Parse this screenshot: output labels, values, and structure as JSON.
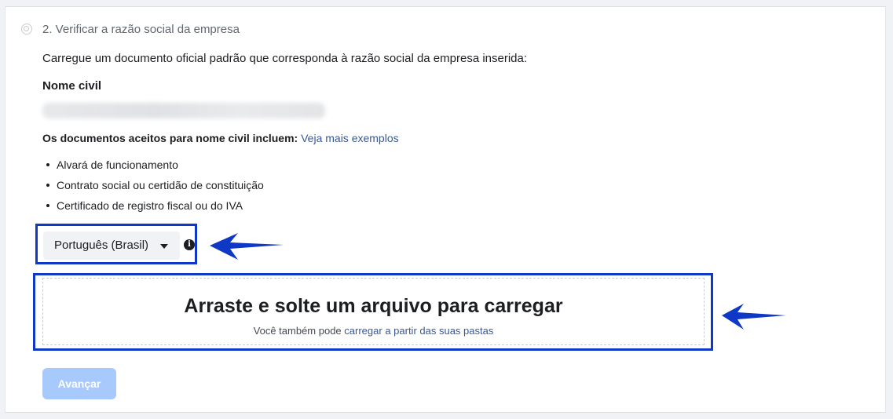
{
  "step": {
    "title": "2. Verificar a razão social da empresa",
    "instructions": "Carregue um documento oficial padrão que corresponda à razão social da empresa inserida:"
  },
  "civil_name": {
    "label": "Nome civil"
  },
  "accepted_docs": {
    "heading": "Os documentos aceitos para nome civil incluem:",
    "link": "Veja mais exemplos",
    "items": [
      "Alvará de funcionamento",
      "Contrato social ou certidão de constituição",
      "Certificado de registro fiscal ou do IVA"
    ]
  },
  "language_select": {
    "value": "Português (Brasil)",
    "icon": "chevron-down-icon",
    "info_icon": "info-icon",
    "info_glyph": "i"
  },
  "upload": {
    "title": "Arraste e solte um arquivo para carregar",
    "subtitle_prefix": "Você também pode",
    "subtitle_link": "carregar a partir das suas pastas"
  },
  "actions": {
    "next_label": "Avançar",
    "next_enabled": false
  },
  "colors": {
    "highlight": "#1038c6",
    "link": "#385898",
    "button_disabled": "#a8c9fb"
  }
}
